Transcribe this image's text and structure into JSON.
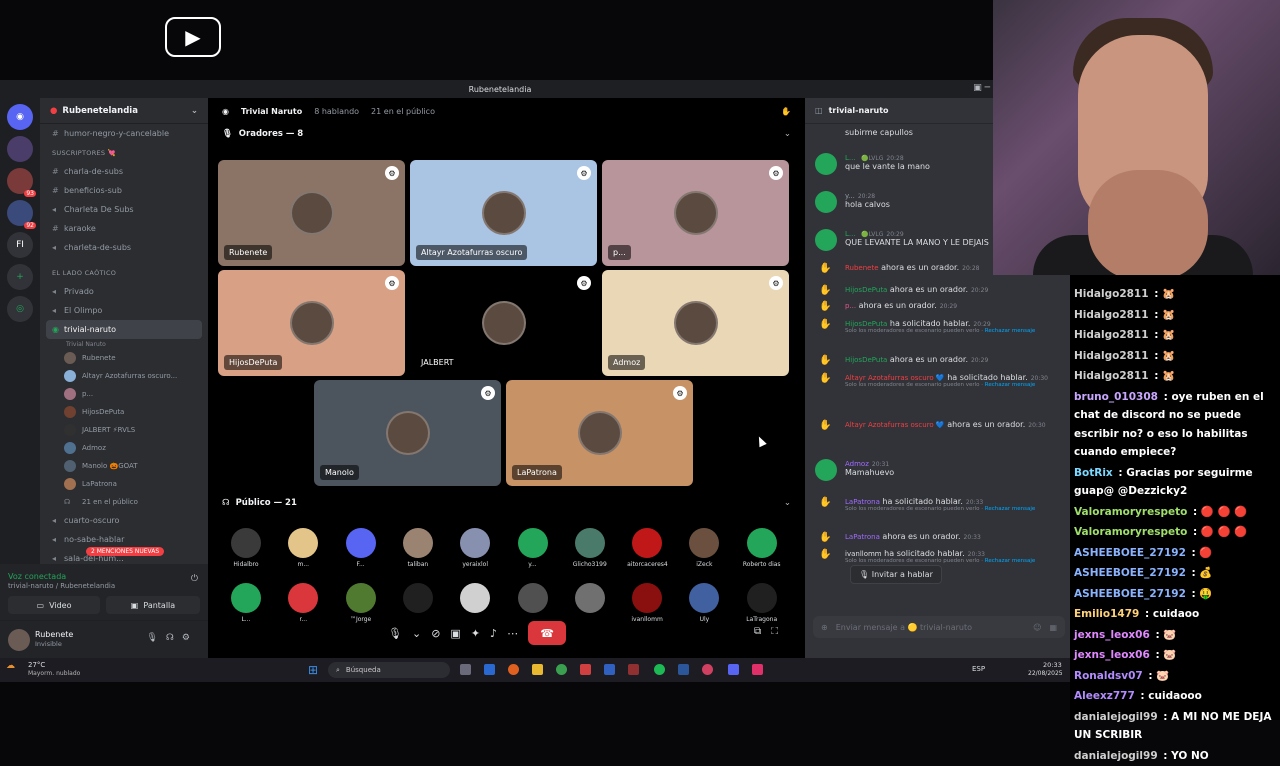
{
  "titlebar": {
    "title": "Rubenetelandia"
  },
  "servers": [
    {
      "label": "FI"
    },
    {
      "badge": "93"
    },
    {
      "badge": "92"
    }
  ],
  "sidebar": {
    "guild": "Rubenetelandia",
    "top_channel": "humor-negro-y-cancelable",
    "cat1": "SUSCRIPTORES 💘",
    "cat1_channels": [
      "charla-de-subs",
      "beneficios-sub",
      "Charleta De Subs",
      "karaoke",
      "charleta-de-subs"
    ],
    "cat2": "EL LADO CAÓTICO",
    "cat2_channels": [
      "Privado",
      "El Olimpo"
    ],
    "active_channel": "trivial-naruto",
    "active_sub": "Trivial Naruto",
    "voice_users": [
      "Rubenete",
      "Altayr Azotafurras oscuro...",
      "p...",
      "HijosDePuta",
      "JALBERT ⚡RVLS",
      "Admoz",
      "Manolo 🎃GOAT",
      "LaPatrona"
    ],
    "public_count": "21 en el público",
    "after": [
      "cuarto-oscuro",
      "no-sabe-hablar",
      "sala-del-hum..."
    ],
    "mentions": "2 MENCIONES NUEVAS"
  },
  "voice_status": {
    "title": "Voz conectada",
    "sub": "trivial-naruto / Rubenetelandia",
    "video": "Video",
    "screen": "Pantalla"
  },
  "user": {
    "name": "Rubenete",
    "status": "Invisible"
  },
  "vc": {
    "title": "Trivial Naruto",
    "speaking": "8 hablando",
    "audience": "21 en el público",
    "speakers_header": "Oradores — 8",
    "public_header": "Público — 21"
  },
  "speakers": [
    {
      "name": "Rubenete",
      "bg": "#8b7366"
    },
    {
      "name": "Altayr Azotafurras oscuro",
      "bg": "#aac4e4"
    },
    {
      "name": "p...",
      "bg": "#b8949b"
    },
    {
      "name": "HijosDePuta",
      "bg": "#d8a084"
    },
    {
      "name": "JALBERT",
      "bg": "#000000"
    },
    {
      "name": "Admoz",
      "bg": "#ead7b6"
    },
    {
      "name": "Manolo",
      "bg": "#4c545e"
    },
    {
      "name": "LaPatrona",
      "bg": "#c79266"
    }
  ],
  "audience": [
    {
      "name": "Hidalbro",
      "c": "#3a3a3a"
    },
    {
      "name": "m...",
      "c": "#e3c58a"
    },
    {
      "name": "F...",
      "c": "#5865f2"
    },
    {
      "name": "taliban",
      "c": "#9b8372"
    },
    {
      "name": "yeraixlol",
      "c": "#8890b0"
    },
    {
      "name": "y...",
      "c": "#23a55a"
    },
    {
      "name": "Glicho3199",
      "c": "#4a7a6a"
    },
    {
      "name": "aitorcaceres4",
      "c": "#c01818"
    },
    {
      "name": "iZeck",
      "c": "#6b5040"
    },
    {
      "name": "Roberto dias",
      "c": "#23a55a"
    },
    {
      "name": "L...",
      "c": "#23a55a"
    },
    {
      "name": "r...",
      "c": "#da373c"
    },
    {
      "name": "™Jorge",
      "c": "#507a30"
    },
    {
      "name": "",
      "c": "#202020"
    },
    {
      "name": "",
      "c": "#d0d0d0"
    },
    {
      "name": "",
      "c": "#505050"
    },
    {
      "name": "",
      "c": "#707070"
    },
    {
      "name": "ivanllomm",
      "c": "#8a1010"
    },
    {
      "name": "Uly",
      "c": "#4060a0"
    },
    {
      "name": "LaTragona",
      "c": "#202020"
    }
  ],
  "chat": {
    "channel": "trivial-naruto",
    "placeholder": "Enviar mensaje a 🟡 trivial-naruto",
    "invite": "Invitar a hablar",
    "note_text": "Solo los moderadores de escenario pueden verlo",
    "note_link": "Rechazar mensaje",
    "messages": [
      {
        "text": "subirme capullos"
      },
      {
        "name": "L...",
        "tag": "🟢LVLG",
        "time": "20:28",
        "text": "que le vante la mano"
      },
      {
        "name": "y...",
        "time": "20:28",
        "text": "hola calvos"
      },
      {
        "name": "L...",
        "tag": "🟢LVLG",
        "time": "20:29",
        "text": "QUE LEVANTE LA MANO Y LE DEJAIS"
      },
      {
        "name": "Rubenete",
        "text": "ahora es un orador.",
        "time": "20:28"
      },
      {
        "name": "HijosDePuta",
        "text": "ahora es un orador.",
        "time": "20:29"
      },
      {
        "name": "p...",
        "text": "ahora es un orador.",
        "time": "20:29"
      },
      {
        "name": "HijosDePuta",
        "text": "ha solicitado hablar.",
        "time": "20:29"
      },
      {
        "name": "HijosDePuta",
        "text": "ahora es un orador.",
        "time": "20:29"
      },
      {
        "name": "Altayr Azotafurras oscuro 💙",
        "text": "ha solicitado hablar.",
        "time": "20:30"
      },
      {
        "name": "Altayr Azotafurras oscuro 💙",
        "text": "ahora es un orador.",
        "time": "20:30"
      },
      {
        "name": "Admoz",
        "time": "20:31",
        "text": "Mamahuevo"
      },
      {
        "name": "LaPatrona",
        "text": "ha solicitado hablar.",
        "time": "20:33"
      },
      {
        "name": "LaPatrona",
        "text": "ahora es un orador.",
        "time": "20:33"
      },
      {
        "name": "ivanllomm",
        "text": "ha solicitado hablar.",
        "time": "20:33"
      }
    ]
  },
  "twitch": [
    {
      "u": "Hidalgo2811",
      "c": "#cfcfcf",
      "m": "🐹"
    },
    {
      "u": "Hidalgo2811",
      "c": "#cfcfcf",
      "m": "🐹"
    },
    {
      "u": "Hidalgo2811",
      "c": "#cfcfcf",
      "m": "🐹"
    },
    {
      "u": "Hidalgo2811",
      "c": "#cfcfcf",
      "m": "🐹"
    },
    {
      "u": "Hidalgo2811",
      "c": "#cfcfcf",
      "m": "🐹"
    },
    {
      "u": "bruno_010308",
      "c": "#c9a7ff",
      "m": "oye ruben en el chat de discord no se puede escribir no? o eso lo habilitas cuando empiece?"
    },
    {
      "u": "BotRix",
      "c": "#7cd9ff",
      "m": "Gracias por seguirme guap@ @Dezzicky2"
    },
    {
      "u": "Valoramoryrespeto",
      "c": "#9fe06a",
      "m": "🔴 🔴 🔴"
    },
    {
      "u": "Valoramoryrespeto",
      "c": "#9fe06a",
      "m": "🔴 🔴 🔴"
    },
    {
      "u": "ASHEEBOEE_27192",
      "c": "#8ab4ff",
      "m": "🔴"
    },
    {
      "u": "ASHEEBOEE_27192",
      "c": "#8ab4ff",
      "m": "💰"
    },
    {
      "u": "ASHEEBOEE_27192",
      "c": "#8ab4ff",
      "m": "🤑"
    },
    {
      "u": "Emilio1479",
      "c": "#ffd27a",
      "m": "cuidaoo"
    },
    {
      "u": "jexns_leox06",
      "c": "#e08aff",
      "m": "🐷"
    },
    {
      "u": "jexns_leox06",
      "c": "#e08aff",
      "m": "🐷"
    },
    {
      "u": "Ronaldsv07",
      "c": "#b38cff",
      "m": "🐷"
    },
    {
      "u": "Aleexz777",
      "c": "#b38cff",
      "m": "cuidaooo"
    },
    {
      "u": "danialejogil99",
      "c": "#cfcfcf",
      "m": "A MI NO ME DEJA UN SCRIBIR"
    },
    {
      "u": "danialejogil99",
      "c": "#cfcfcf",
      "m": "YO NO"
    }
  ],
  "taskbar": {
    "temp": "27°C",
    "weather": "Mayorm. nublado",
    "search": "Búsqueda",
    "lang": "ESP",
    "time": "20:33",
    "date": "22/08/2025"
  }
}
